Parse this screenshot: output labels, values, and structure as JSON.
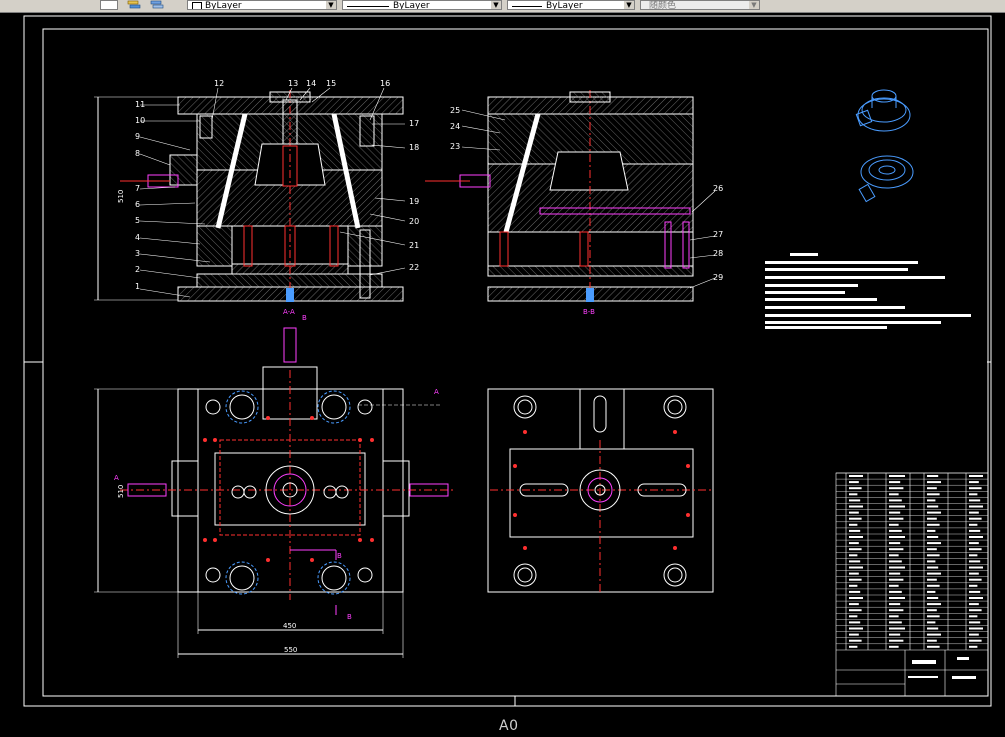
{
  "toolbar": {
    "color_combo": "ByLayer",
    "linetype_combo": "ByLayer",
    "lineweight_combo": "ByLayer",
    "plotstyle_combo": "随颜色"
  },
  "drawing": {
    "part_numbers_left": [
      "1",
      "2",
      "3",
      "4",
      "5",
      "6",
      "7",
      "8",
      "9",
      "10",
      "11"
    ],
    "part_numbers_top": [
      "12",
      "13",
      "14",
      "15",
      "16"
    ],
    "part_numbers_right": [
      "17",
      "18",
      "19",
      "20",
      "21",
      "22"
    ],
    "part_numbers_b": [
      "23",
      "24",
      "25",
      "26",
      "27",
      "28",
      "29"
    ],
    "section_label_aa": "A-A",
    "section_label_bb": "B-B",
    "cut_label_a": "A",
    "cut_label_b": "B",
    "dim_height": "510",
    "dim_height2": "510",
    "dim_width_450": "450",
    "dim_width_550": "550"
  },
  "layout_tab": "A0",
  "colors": {
    "background": "#000000",
    "line": "#ffffff",
    "centerline": "#ff2020",
    "accent_magenta": "#ff40ff",
    "accent_blue": "#4a9cff",
    "toolbar_bg": "#d4d0c8"
  }
}
